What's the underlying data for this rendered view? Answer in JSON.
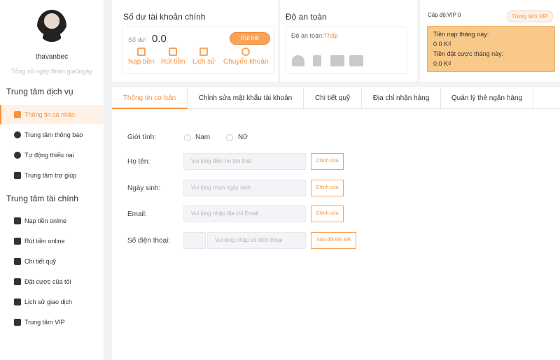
{
  "sidebar": {
    "username": "thavanbec",
    "subtext": "Tổng số ngày tham gia0ngày",
    "service_title": "Trung tâm dịch vụ",
    "service_items": [
      {
        "label": "Thông tin cá nhân",
        "icon": "id-card-icon"
      },
      {
        "label": "Trung tâm thông báo",
        "icon": "chat-icon"
      },
      {
        "label": "Tự động thiếu nại",
        "icon": "clock-icon"
      },
      {
        "label": "Trung tâm trợ giúp",
        "icon": "book-icon"
      }
    ],
    "finance_title": "Trung tâm tài chính",
    "finance_items": [
      {
        "label": "Nạp tiền online",
        "icon": "deposit-icon"
      },
      {
        "label": "Rút tiền online",
        "icon": "withdraw-icon"
      },
      {
        "label": "Chi tiết quỹ",
        "icon": "wallet-icon"
      },
      {
        "label": "Đặt cược của tôi",
        "icon": "bet-slip-icon"
      },
      {
        "label": "Lịch sử giao dịch",
        "icon": "history-icon"
      },
      {
        "label": "Trung tâm VIP",
        "icon": "crown-icon"
      }
    ]
  },
  "balance": {
    "title": "Số dư tài khoản chính",
    "label": "Số dư:",
    "value": "0.0",
    "withdraw_label": "Rút hết",
    "actions": [
      {
        "label": "Nạp tiền",
        "icon": "deposit-icon"
      },
      {
        "label": "Rút tiền",
        "icon": "withdraw-icon"
      },
      {
        "label": "Lịch sử",
        "icon": "history-icon"
      },
      {
        "label": "Chuyển khoản",
        "icon": "transfer-icon"
      }
    ]
  },
  "security": {
    "title": "Độ an toàn",
    "label": "Độ an toàn:",
    "level": "Thấp",
    "icons": [
      "user-icon",
      "phone-icon",
      "mail-icon",
      "bank-card-icon"
    ]
  },
  "vip": {
    "level": "Cấp độ:VIP 0",
    "button": "Trung tâm VIP",
    "deposit_label": "Tiền nạp tháng này:",
    "deposit_value": "0.0 K₫",
    "bet_label": "Tiền đặt cược tháng này:",
    "bet_value": "0.0 K₫"
  },
  "tabs": [
    "Thông tin cơ bản",
    "Chỉnh sửa mật khẩu tài khoản",
    "Chi tiết quỹ",
    "Địa chỉ nhận hàng",
    "Quản lý thẻ ngân hàng"
  ],
  "form": {
    "gender_label": "Giới tính:",
    "gender_male": "Nam",
    "gender_female": "Nữ",
    "name_label": "Họ tên:",
    "name_placeholder": "Vui lòng điền họ tên thật",
    "dob_label": "Ngày sinh:",
    "dob_placeholder": "Vui lòng chọn ngày sinh",
    "email_label": "Email:",
    "email_placeholder": "Vui lòng nhập địa chỉ Email",
    "phone_label": "Số điện thoại:",
    "phone_placeholder": "Vui lòng nhập số điện thoại",
    "edit_label": "Chỉnh sửa",
    "phone_edit_label": "Sửa đổi liên kết"
  },
  "colors": {
    "accent": "#f7913d",
    "vip_box": "#f8c988"
  }
}
